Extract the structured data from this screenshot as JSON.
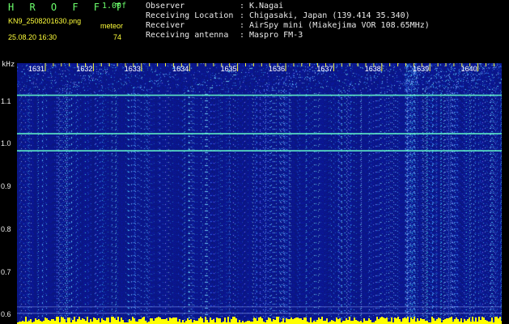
{
  "header": {
    "brand": "H R O F F T",
    "version": "1.00f",
    "filename": "KN9_2508201630.png",
    "timestamp": "25.08.20 16:30",
    "meteor_label": "meteor",
    "meteor_count": "74"
  },
  "meta": [
    {
      "key": "Observer",
      "value": "K.Nagai"
    },
    {
      "key": "Receiving Location",
      "value": "Chigasaki, Japan (139.414 35.340)"
    },
    {
      "key": "Receiver",
      "value": "AirSpy mini (Miakejima VOR 108.65MHz)"
    },
    {
      "key": "Receiving antenna",
      "value": "Maspro FM-3"
    }
  ],
  "separator": ":",
  "chart_data": {
    "type": "heatmap",
    "ylabel": "kHz",
    "x_ticks": [
      "1631",
      "1632",
      "1633",
      "1634",
      "1635",
      "1636",
      "1637",
      "1638",
      "1639",
      "1640"
    ],
    "y_ticks": [
      "1.1",
      "1.0",
      "0.9",
      "0.8",
      "0.7",
      "0.6"
    ],
    "ylim": [
      0.58,
      1.19
    ],
    "horizontal_lines_khz": [
      1.115,
      1.025,
      0.985,
      0.62,
      0.605
    ],
    "colors": {
      "background": "#0a1a8c",
      "noise": "#3a6cff",
      "line": "#66ffcc",
      "tick": "#ffff33",
      "footer_bar": "#ffff00"
    }
  }
}
